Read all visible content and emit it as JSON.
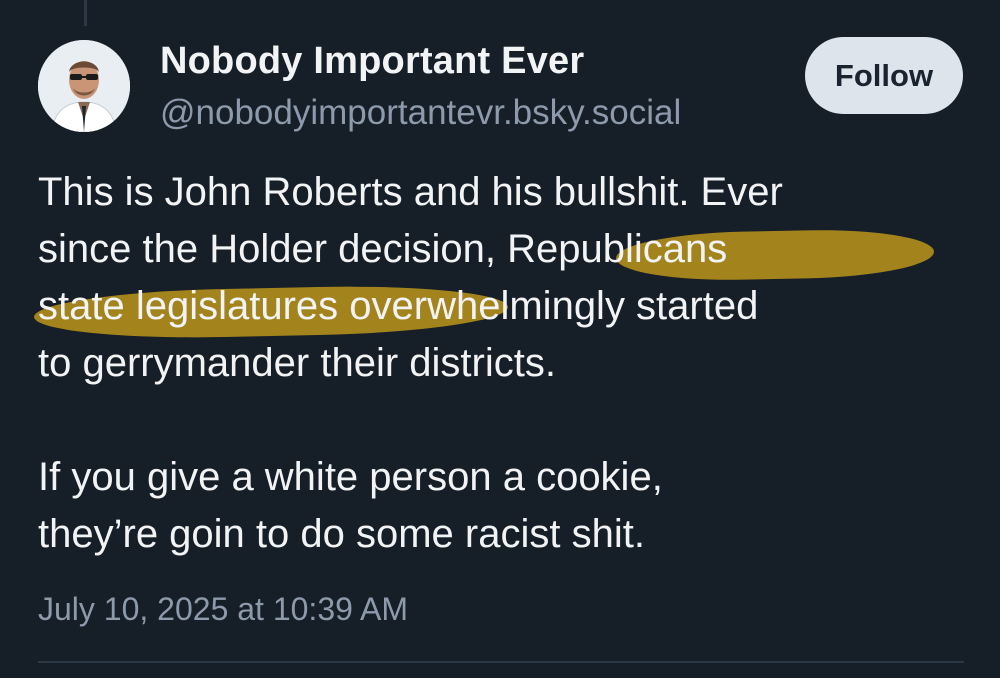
{
  "author": {
    "display_name": "Nobody Important Ever",
    "handle": "@nobodyimportantevr.bsky.social",
    "avatar_icon": "user-avatar"
  },
  "actions": {
    "follow_label": "Follow"
  },
  "post": {
    "paragraph_1": {
      "line_1": "This is John Roberts and his bullshit. Ever",
      "line_2_plain": "since the Holder decision, ",
      "line_2_highlight": "Republicans",
      "line_3_highlight": "state legislatures over",
      "line_3_plain": "whelmingly started",
      "line_4": "to gerrymander their districts."
    },
    "paragraph_2": {
      "line_1": "If you give a white person a cookie,",
      "line_2": "they’re goin to do some racist shit."
    },
    "timestamp": "July 10, 2025 at 10:39 AM"
  },
  "colors": {
    "background": "#161e27",
    "text": "#f1f3f5",
    "muted": "#8c9aab",
    "highlight": "#cca01a",
    "button_bg": "#dde4ec"
  }
}
